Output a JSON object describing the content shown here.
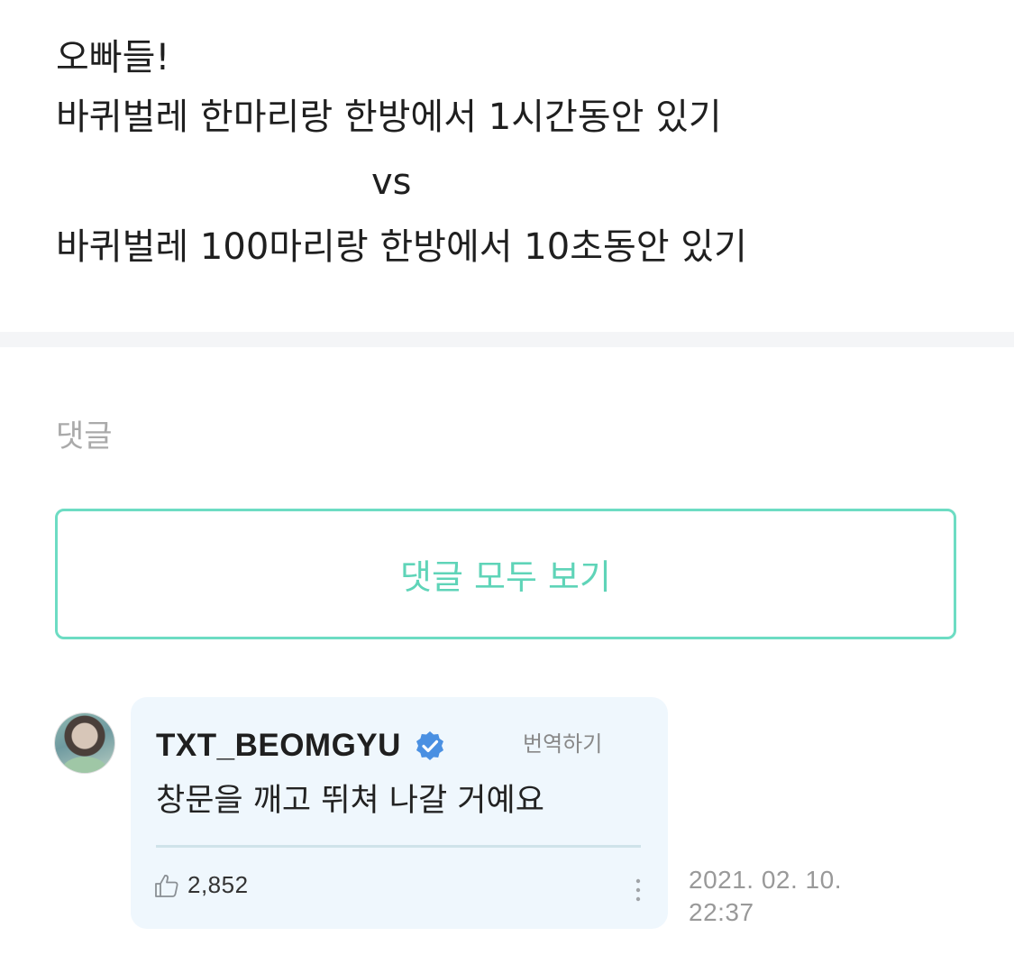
{
  "post": {
    "lines": [
      "오빠들!",
      "바퀴벌레 한마리랑 한방에서 1시간동안 있기",
      "vs",
      "바퀴벌레 100마리랑 한방에서 10초동안 있기"
    ]
  },
  "comments_section": {
    "heading": "댓글",
    "view_all_label": "댓글 모두 보기"
  },
  "comment": {
    "author": "TXT_BEOMGYU",
    "verified": true,
    "translate_label": "번역하기",
    "text": "창문을 깨고 뛰쳐 나갈 거예요",
    "like_count": "2,852",
    "date": "2021. 02. 10.",
    "time": "22:37"
  },
  "colors": {
    "accent": "#5fd4b8",
    "card_background": "#eff7fd",
    "verified_badge": "#4a90e2",
    "divider": "#f4f5f7"
  },
  "icons": {
    "verified": "verified-badge-icon",
    "like": "thumbs-up-icon",
    "more": "more-vertical-icon",
    "avatar": "avatar-image"
  }
}
